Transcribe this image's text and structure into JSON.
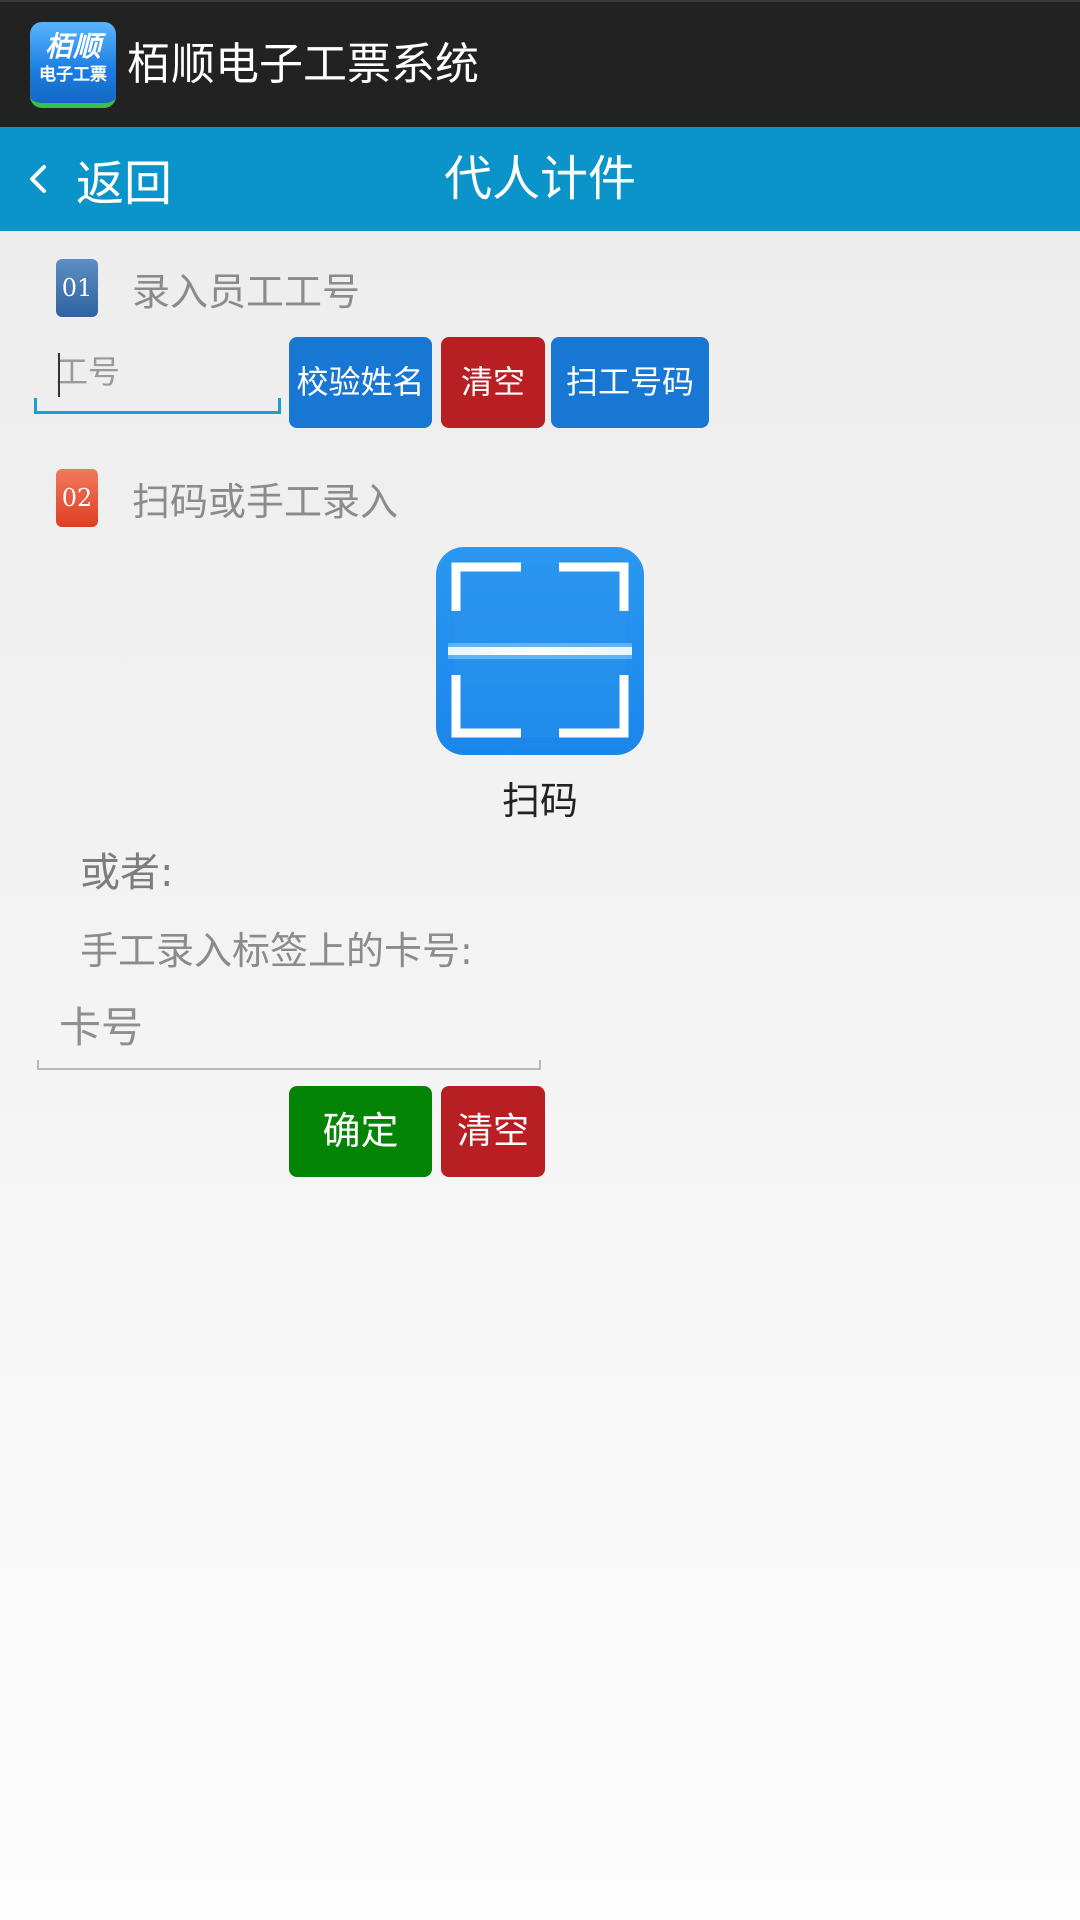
{
  "titlebar": {
    "app_name": "栢顺电子工票系统",
    "icon": {
      "line1": "栢顺",
      "line2": "电子工票"
    }
  },
  "navbar": {
    "back_label": "返回",
    "title": "代人计件",
    "color": "#0a94c9"
  },
  "section1": {
    "badge": "01",
    "title": "录入员工工号",
    "input_placeholder": "工号",
    "buttons": {
      "verify": "校验姓名",
      "clear": "清空",
      "scan_id": "扫工号码"
    }
  },
  "section2": {
    "badge": "02",
    "title": "扫码或手工录入",
    "scan_icon": "barcode-scan-icon",
    "scan_label": "扫码",
    "or_text": "或者:",
    "manual_text": "手工录入标签上的卡号:",
    "card_placeholder": "卡号",
    "buttons": {
      "confirm": "确定",
      "clear": "清空"
    }
  },
  "colors": {
    "button_blue": "#1877d2",
    "button_red": "#b81f23",
    "button_green": "#048404"
  }
}
